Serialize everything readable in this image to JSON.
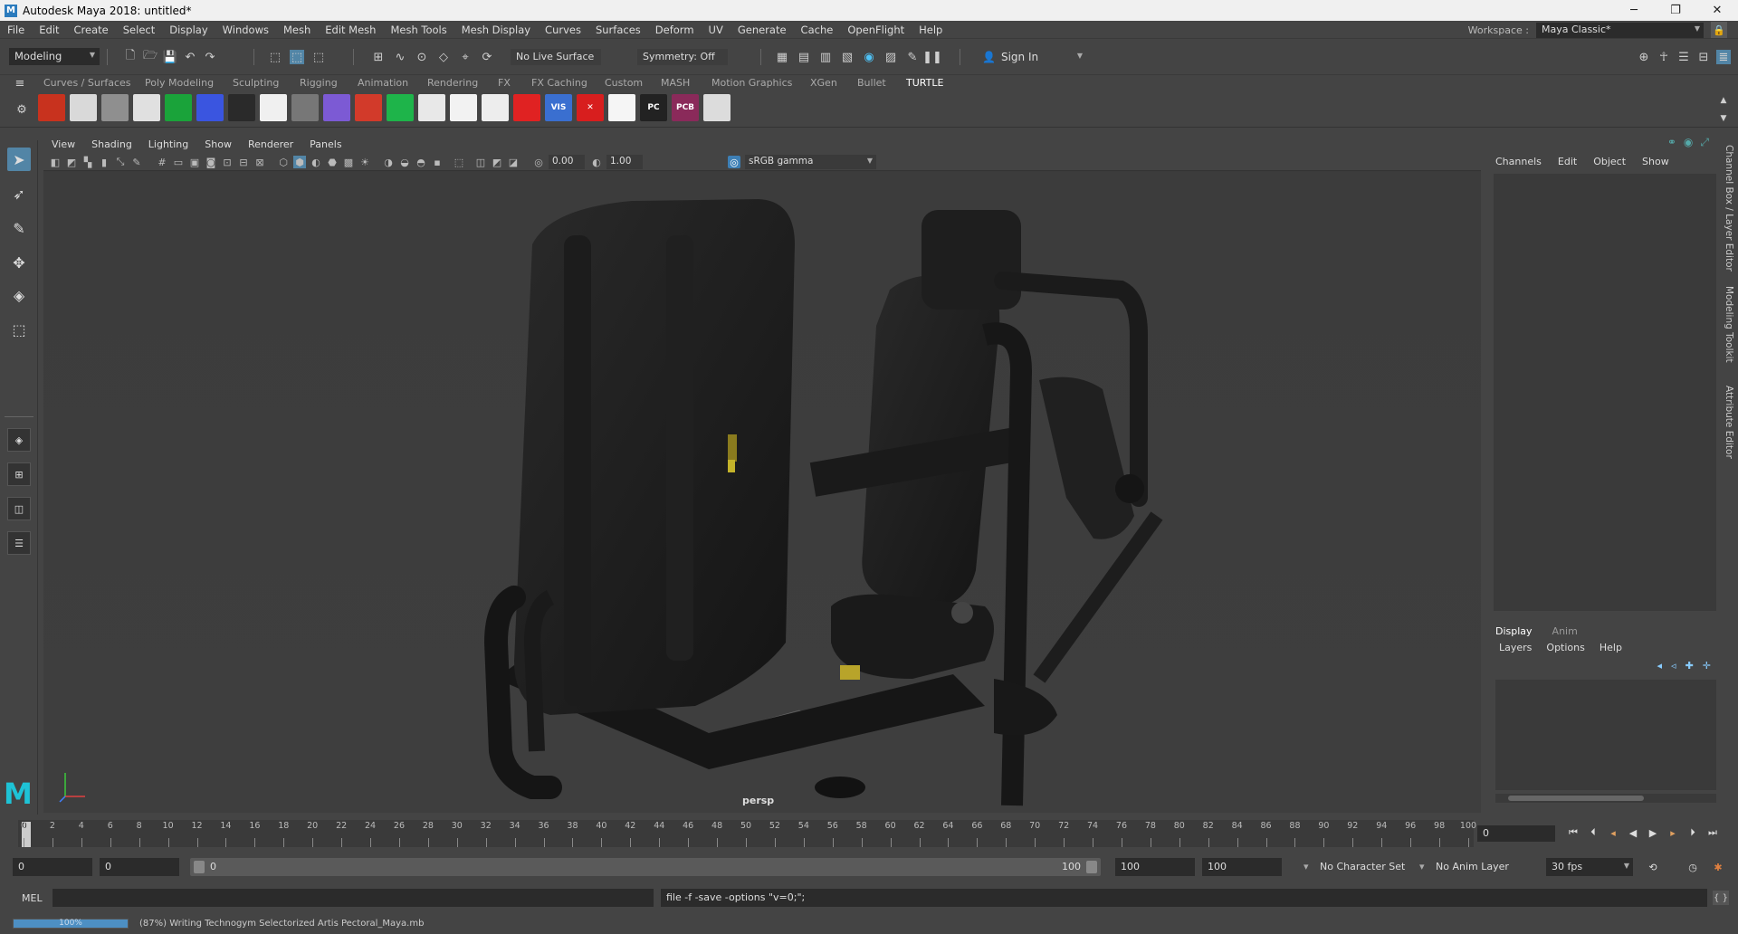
{
  "window": {
    "title": "Autodesk Maya 2018: untitled*",
    "app_icon": "M",
    "controls": [
      "minimize-icon",
      "restore-icon",
      "close-icon"
    ]
  },
  "menu": [
    "File",
    "Edit",
    "Create",
    "Select",
    "Display",
    "Windows",
    "Mesh",
    "Edit Mesh",
    "Mesh Tools",
    "Mesh Display",
    "Curves",
    "Surfaces",
    "Deform",
    "UV",
    "Generate",
    "Cache",
    "OpenFlight",
    "Help"
  ],
  "workspace": {
    "label": "Workspace :",
    "value": "Maya Classic*"
  },
  "status_line": {
    "mode": "Modeling",
    "live_surface": "No Live Surface",
    "symmetry": "Symmetry: Off",
    "sign_in": "Sign In"
  },
  "shelf": {
    "tabs": [
      "Curves / Surfaces",
      "Poly Modeling",
      "Sculpting",
      "Rigging",
      "Animation",
      "Rendering",
      "FX",
      "FX Caching",
      "Custom",
      "MASH",
      "Motion Graphics",
      "XGen",
      "Bullet",
      "TURTLE"
    ],
    "active_tab": "TURTLE",
    "buttons": [
      {
        "name": "turtle-render",
        "label": "",
        "color": "#c8321e"
      },
      {
        "name": "bake",
        "label": "",
        "color": "#d9d9d9"
      },
      {
        "name": "sphere-grey",
        "label": "",
        "color": "#8f8f8f"
      },
      {
        "name": "sphere-light",
        "label": "",
        "color": "#e0e0e0"
      },
      {
        "name": "green-sphere",
        "label": "",
        "color": "#1aa33a"
      },
      {
        "name": "blue-grid",
        "label": "",
        "color": "#3a55e0"
      },
      {
        "name": "rgb-lights",
        "label": "",
        "color": "#2a2a2a"
      },
      {
        "name": "cells",
        "label": "",
        "color": "#f0f0f0"
      },
      {
        "name": "grey-disk",
        "label": "",
        "color": "#777777"
      },
      {
        "name": "purple-box",
        "label": "",
        "color": "#7c5ad4"
      },
      {
        "name": "red-box",
        "label": "",
        "color": "#d23a2a"
      },
      {
        "name": "green-cone",
        "label": "",
        "color": "#1eb44a"
      },
      {
        "name": "terrain",
        "label": "",
        "color": "#e8e8e8"
      },
      {
        "name": "white-sphere",
        "label": "",
        "color": "#f2f2f2"
      },
      {
        "name": "white-oval",
        "label": "",
        "color": "#ededed"
      },
      {
        "name": "red-eye",
        "label": "",
        "color": "#e02222"
      },
      {
        "name": "hw-vis",
        "label": "VIS",
        "color": "#3a6fd0"
      },
      {
        "name": "x-delete",
        "label": "✕",
        "color": "#d81e1e"
      },
      {
        "name": "white-block",
        "label": "",
        "color": "#f5f5f5"
      },
      {
        "name": "pc",
        "label": "PC",
        "color": "#222222"
      },
      {
        "name": "pcb",
        "label": "PCB",
        "color": "#8a2a5a"
      },
      {
        "name": "search-tex",
        "label": "",
        "color": "#dcdcdc"
      }
    ]
  },
  "viewport": {
    "menu": [
      "View",
      "Shading",
      "Lighting",
      "Show",
      "Renderer",
      "Panels"
    ],
    "exposure": "0.00",
    "gamma": "1.00",
    "color_space": "sRGB gamma",
    "camera": "persp"
  },
  "channel_box": {
    "menu": [
      "Channels",
      "Edit",
      "Object",
      "Show"
    ],
    "side_tabs": [
      "Channel Box / Layer Editor",
      "Modeling Toolkit",
      "Attribute Editor"
    ]
  },
  "layer_editor": {
    "tabs": [
      "Display",
      "Anim"
    ],
    "active_tab": "Display",
    "menu": [
      "Layers",
      "Options",
      "Help"
    ]
  },
  "timeline": {
    "ticks": [
      0,
      2,
      4,
      6,
      8,
      10,
      12,
      14,
      16,
      18,
      20,
      22,
      24,
      26,
      28,
      30,
      32,
      34,
      36,
      38,
      40,
      42,
      44,
      46,
      48,
      50,
      52,
      54,
      56,
      58,
      60,
      62,
      64,
      66,
      68,
      70,
      72,
      74,
      76,
      78,
      80,
      82,
      84,
      86,
      88,
      90,
      92,
      94,
      96,
      98,
      100
    ],
    "current_frame": "0",
    "current_field": "0"
  },
  "range": {
    "start_field": "0",
    "anim_start": "0",
    "bar_start": "0",
    "bar_end": "100",
    "anim_end": "100",
    "end_field": "100",
    "character_set": "No Character Set",
    "anim_layer": "No Anim Layer",
    "fps": "30 fps"
  },
  "command_line": {
    "language": "MEL",
    "result": "file -f -save  -options \"v=0;\";"
  },
  "help_line": {
    "progress_percent": "100%",
    "progress": 1.0,
    "message": "(87%) Writing Technogym Selectorized Artis Pectoral_Maya.mb"
  }
}
